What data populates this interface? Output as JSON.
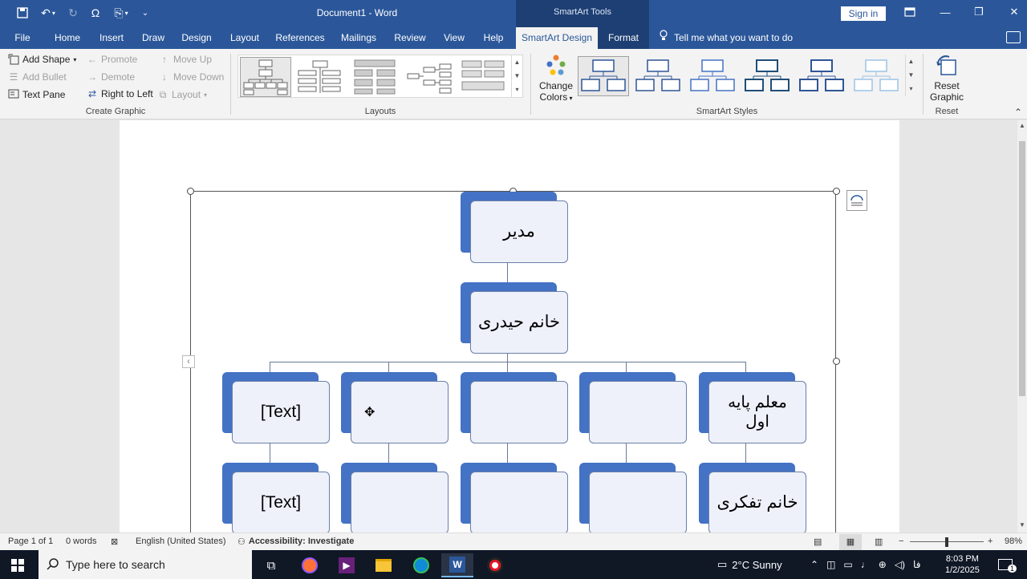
{
  "window": {
    "title": "Document1  -  Word",
    "contextual_header": "SmartArt Tools",
    "sign_in": "Sign in"
  },
  "tabs": [
    {
      "label": "File"
    },
    {
      "label": "Home"
    },
    {
      "label": "Insert"
    },
    {
      "label": "Draw"
    },
    {
      "label": "Design"
    },
    {
      "label": "Layout"
    },
    {
      "label": "References"
    },
    {
      "label": "Mailings"
    },
    {
      "label": "Review"
    },
    {
      "label": "View"
    },
    {
      "label": "Help"
    },
    {
      "label": "SmartArt Design"
    },
    {
      "label": "Format"
    }
  ],
  "tell_me": "Tell me what you want to do",
  "ribbon": {
    "create_graphic": {
      "label": "Create Graphic",
      "add_shape": "Add Shape",
      "add_bullet": "Add Bullet",
      "text_pane": "Text Pane",
      "promote": "Promote",
      "demote": "Demote",
      "right_to_left": "Right to Left",
      "move_up": "Move Up",
      "move_down": "Move Down",
      "layout": "Layout"
    },
    "layouts": {
      "label": "Layouts"
    },
    "smartart_styles": {
      "label": "SmartArt Styles",
      "change_colors_1": "Change",
      "change_colors_2": "Colors"
    },
    "reset": {
      "label": "Reset",
      "reset_graphic_1": "Reset",
      "reset_graphic_2": "Graphic"
    }
  },
  "diagram": {
    "top": "مدیر",
    "second": "خانم حیدری",
    "row3": [
      "[Text]",
      "",
      "",
      "",
      "معلم پایه اول"
    ],
    "row4": [
      "[Text]",
      "",
      "",
      "",
      "خانم تفکری"
    ]
  },
  "status": {
    "page": "Page 1 of 1",
    "words": "0 words",
    "language": "English (United States)",
    "accessibility": "Accessibility: Investigate",
    "zoom": "98%"
  },
  "taskbar": {
    "search_placeholder": "Type here to search",
    "weather": "2°C  Sunny",
    "lang": "فا",
    "time": "8:03 PM",
    "date": "1/2/2025",
    "notifications": "1"
  }
}
